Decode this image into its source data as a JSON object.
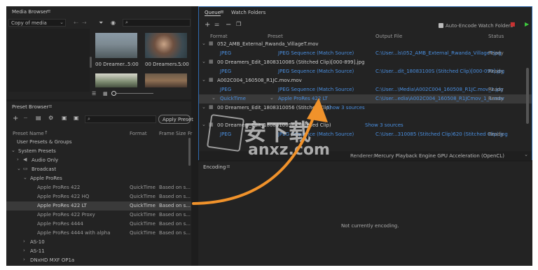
{
  "media_browser": {
    "title": "Media Browser",
    "location": "Copy of media",
    "search_placeholder": "",
    "thumbs": [
      {
        "label": "00 Dreamer...",
        "dur": "5:00"
      },
      {
        "label": "00 Dreamers...",
        "dur": "5:00"
      }
    ]
  },
  "preset_browser": {
    "title": "Preset Browser",
    "apply_label": "Apply Preset",
    "cols": {
      "name": "Preset Name",
      "format": "Format",
      "frame": "Frame Size",
      "fr": "Fr"
    },
    "rows": [
      {
        "name": "User Presets & Groups",
        "format": "",
        "frame": ""
      },
      {
        "name": "System Presets",
        "format": "",
        "frame": ""
      },
      {
        "name": "Audio Only",
        "format": "",
        "frame": ""
      },
      {
        "name": "Broadcast",
        "format": "",
        "frame": ""
      },
      {
        "name": "Apple ProRes",
        "format": "",
        "frame": ""
      },
      {
        "name": "Apple ProRes 422",
        "format": "QuickTime",
        "frame": "Based on s..."
      },
      {
        "name": "Apple ProRes 422 HQ",
        "format": "QuickTime",
        "frame": "Based on s..."
      },
      {
        "name": "Apple ProRes 422 LT",
        "format": "QuickTime",
        "frame": "Based on s..."
      },
      {
        "name": "Apple ProRes 422 Proxy",
        "format": "QuickTime",
        "frame": "Based on s..."
      },
      {
        "name": "Apple ProRes 4444",
        "format": "QuickTime",
        "frame": "Based on s..."
      },
      {
        "name": "Apple ProRes 4444 with alpha",
        "format": "QuickTime",
        "frame": "Based on s..."
      },
      {
        "name": "AS-10",
        "format": "",
        "frame": ""
      },
      {
        "name": "AS-11",
        "format": "",
        "frame": ""
      },
      {
        "name": "DNxHD MXF OP1a",
        "format": "",
        "frame": ""
      }
    ]
  },
  "queue": {
    "tab_queue": "Queue",
    "tab_watch": "Watch Folders",
    "auto_encode": "Auto-Encode Watch Folders",
    "cols": {
      "format": "Format",
      "preset": "Preset",
      "output": "Output File",
      "status": "Status"
    },
    "items": [
      {
        "source": "052_AMB_External_Rwanda_VillageT.mov",
        "format": "JPEG",
        "preset": "JPEG Sequence (Match Source)",
        "output": "C:\\User...ls\\052_AMB_External_Rwanda_VillageT.jpg",
        "status": "Ready"
      },
      {
        "source": "00 Dreamers_Edit_180831008S (Stitched Clip)[000-899].jpg",
        "format": "JPEG",
        "preset": "JPEG Sequence (Match Source)",
        "output": "C:\\User...dit_18083100S (Stitched Clip)[000-099].jpg",
        "status": "Ready"
      },
      {
        "source": "A002C004_160508_R1JC.mov.mov",
        "format": "JPEG",
        "preset": "JPEG Sequence (Match Source)",
        "output": "C:\\User...\\Media\\A002C004_160508_R1JC.mov_1.jpg",
        "status": "Ready"
      },
      {
        "source": "",
        "format": "QuickTime",
        "preset": "Apple ProRes 422 LT",
        "output": "C:\\User...edia\\A002C004_160508_R1JCmov_1_1.mov",
        "status": "Ready"
      },
      {
        "source": "00 Dreamers_Edit_1808310056 (Stitched Clip)",
        "format": "",
        "preset": "",
        "output": "",
        "status": ""
      },
      {
        "source": "00 Dreamers_Edit_1808310056 (Stitched Clip)",
        "format": "JPEG",
        "preset": "JPEG Sequence (Match Source)",
        "output": "C:\\User...310085 (Stitched Clip)620 (Stitched Clip).jpg",
        "status": "Ready"
      }
    ],
    "show_sources": "Show 3 sources",
    "show_sources2": "Show 3 sources",
    "renderer_label": "Renderer:",
    "renderer_value": "Mercury Playback Engine GPU Acceleration (OpenCL)"
  },
  "encoding": {
    "title": "Encoding",
    "status": "Not currently encoding."
  },
  "watermark": {
    "text": "安下载",
    "sub": "anxz.com"
  },
  "colors": {
    "accent": "#4a8fe0",
    "arrow": "#f0922b",
    "green": "#3ec83e",
    "red": "#c83232"
  }
}
